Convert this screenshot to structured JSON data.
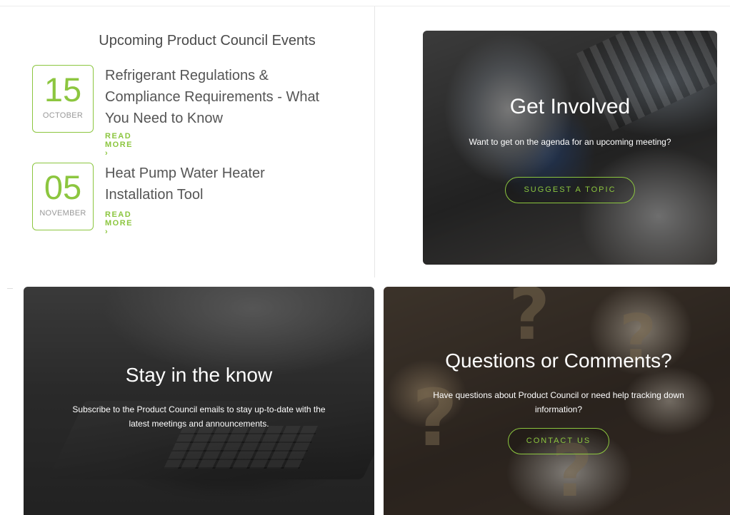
{
  "events": {
    "heading": "Upcoming Product Council Events",
    "items": [
      {
        "day": "15",
        "month": "OCTOBER",
        "title": "Refrigerant Regulations & Compliance Requirements - What You Need to Know",
        "link_label": "READ MORE ›"
      },
      {
        "day": "05",
        "month": "NOVEMBER",
        "title": "Heat Pump Water Heater Installation Tool",
        "link_label": "READ MORE ›"
      }
    ]
  },
  "get_involved": {
    "title": "Get Involved",
    "text": "Want to get on the agenda for an upcoming meeting?",
    "button_label": "SUGGEST A TOPIC"
  },
  "stay_in_know": {
    "title": "Stay in the know",
    "text": "Subscribe to the Product Council emails to stay up-to-date with the latest meetings and announcements."
  },
  "questions": {
    "title": "Questions or Comments?",
    "text": "Have questions about Product Council or need help tracking down information?",
    "button_label": "CONTACT US"
  },
  "colors": {
    "accent": "#8cc63f",
    "text": "#555555"
  }
}
